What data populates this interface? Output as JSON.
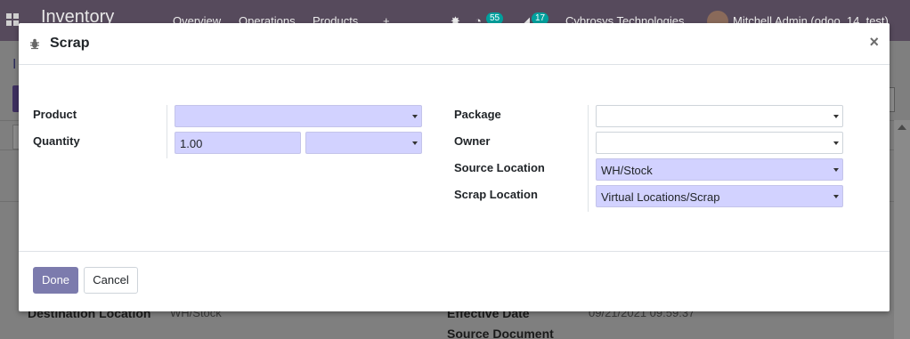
{
  "background": {
    "nav": {
      "brand": "Inventory",
      "menu": [
        "Overview",
        "Operations",
        "Products"
      ],
      "plus": "+",
      "bug": "✸",
      "activity_count": "55",
      "message_count": "17",
      "company": "Cybrosys Technologies",
      "user": "Mitchell Admin (odoo_14_test)"
    },
    "breadcrumb": "I",
    "fields": {
      "destination_location_label": "Destination Location",
      "destination_location_value": "WH/Stock",
      "effective_date_label": "Effective Date",
      "effective_date_value": "09/21/2021 09:59:37",
      "source_document_label": "Source Document"
    }
  },
  "modal": {
    "title": "Scrap",
    "close": "×",
    "left_fields": {
      "product_label": "Product",
      "product_value": "",
      "quantity_label": "Quantity",
      "quantity_value": "1.00",
      "uom_value": ""
    },
    "right_fields": {
      "package_label": "Package",
      "package_value": "",
      "owner_label": "Owner",
      "owner_value": "",
      "source_location_label": "Source Location",
      "source_location_value": "WH/Stock",
      "scrap_location_label": "Scrap Location",
      "scrap_location_value": "Virtual Locations/Scrap"
    },
    "footer": {
      "done": "Done",
      "cancel": "Cancel"
    }
  },
  "colors": {
    "primary": "#7c7bad",
    "required_field": "#d2d2ff",
    "navbar": "#564a5c",
    "backdrop": "#808080"
  }
}
